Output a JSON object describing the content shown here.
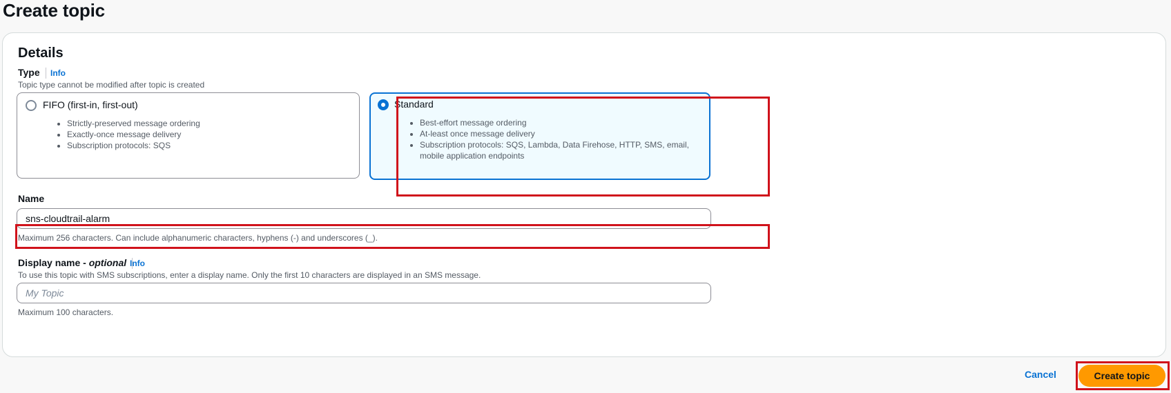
{
  "page": {
    "title": "Create topic"
  },
  "details": {
    "title": "Details",
    "type": {
      "label": "Type",
      "info": "Info",
      "description": "Topic type cannot be modified after topic is created",
      "options": [
        {
          "label": "FIFO (first-in, first-out)",
          "selected": false,
          "bullets": [
            "Strictly-preserved message ordering",
            "Exactly-once message delivery",
            "Subscription protocols: SQS"
          ]
        },
        {
          "label": "Standard",
          "selected": true,
          "bullets": [
            "Best-effort message ordering",
            "At-least once message delivery",
            "Subscription protocols: SQS, Lambda, Data Firehose, HTTP, SMS, email, mobile application endpoints"
          ]
        }
      ]
    },
    "name": {
      "label": "Name",
      "value": "sns-cloudtrail-alarm",
      "hint": "Maximum 256 characters. Can include alphanumeric characters, hyphens (-) and underscores (_)."
    },
    "display_name": {
      "label": "Display name - ",
      "label_optional": "optional",
      "info": "Info",
      "description": "To use this topic with SMS subscriptions, enter a display name. Only the first 10 characters are displayed in an SMS message.",
      "placeholder": "My Topic",
      "value": "",
      "hint": "Maximum 100 characters."
    }
  },
  "footer": {
    "cancel_label": "Cancel",
    "submit_label": "Create topic"
  },
  "colors": {
    "accent": "#0972d3",
    "primary_button": "#ff9900",
    "highlight": "#d0121b"
  }
}
